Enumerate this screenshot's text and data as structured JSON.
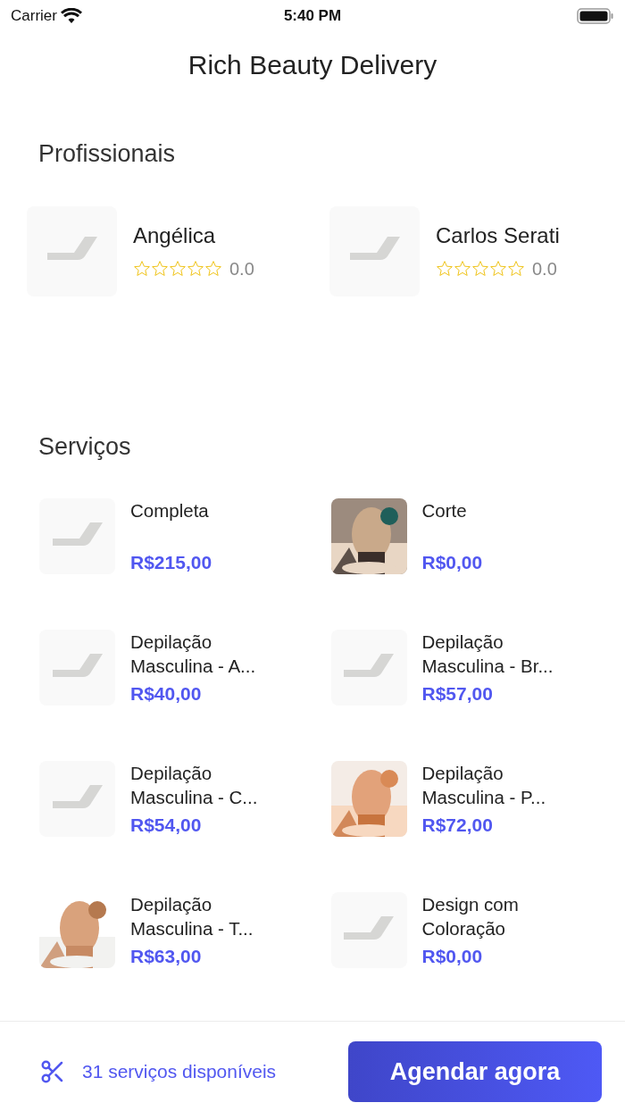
{
  "status_bar": {
    "carrier": "Carrier",
    "time": "5:40 PM"
  },
  "title": "Rich Beauty Delivery",
  "professionals": {
    "heading": "Profissionais",
    "items": [
      {
        "name": "Angélica",
        "stars": 0,
        "rating": "0.0"
      },
      {
        "name": "Carlos Serati",
        "stars": 0,
        "rating": "0.0"
      }
    ]
  },
  "services": {
    "heading": "Serviços",
    "items": [
      {
        "name": "Completa",
        "price": "R$215,00",
        "kind": "placeholder"
      },
      {
        "name": "Corte",
        "price": "R$0,00",
        "kind": "picture"
      },
      {
        "name": "Depilação Masculina - A...",
        "price": "R$40,00",
        "kind": "placeholder"
      },
      {
        "name": "Depilação Masculina - Br...",
        "price": "R$57,00",
        "kind": "placeholder"
      },
      {
        "name": "Depilação Masculina - C...",
        "price": "R$54,00",
        "kind": "placeholder"
      },
      {
        "name": "Depilação Masculina - P...",
        "price": "R$72,00",
        "kind": "picture"
      },
      {
        "name": "Depilação Masculina - T...",
        "price": "R$63,00",
        "kind": "picture"
      },
      {
        "name": "Design com Coloração",
        "price": "R$0,00",
        "kind": "placeholder"
      }
    ]
  },
  "footer": {
    "count": "31 serviços disponíveis",
    "button": "Agendar agora"
  }
}
